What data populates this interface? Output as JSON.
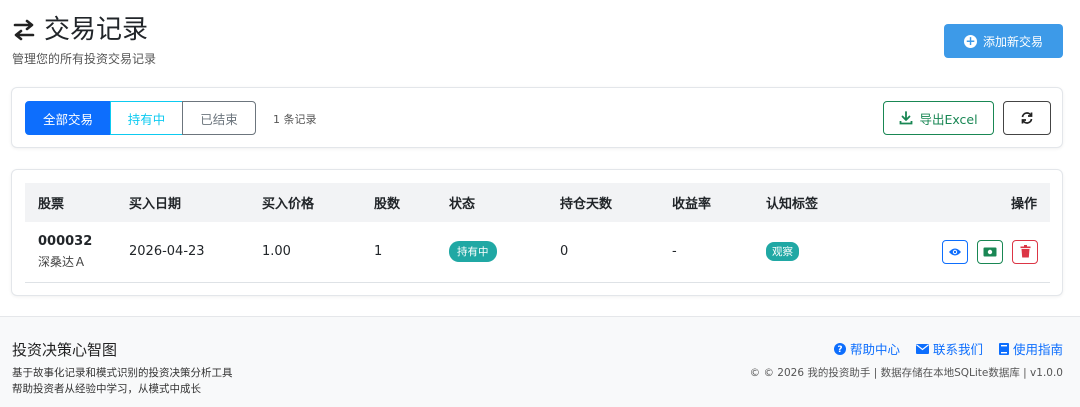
{
  "header": {
    "title": "交易记录",
    "subtitle": "管理您的所有投资交易记录",
    "add_button": "添加新交易",
    "add_icon": "plus-circle-icon",
    "title_icon": "swap-arrows-icon"
  },
  "filters": {
    "all": "全部交易",
    "holding": "持有中",
    "closed": "已结束",
    "record_count": "1 条记录",
    "export": "导出Excel",
    "export_icon": "download-icon",
    "refresh_icon": "refresh-icon"
  },
  "table": {
    "columns": [
      "股票",
      "买入日期",
      "买入价格",
      "股数",
      "状态",
      "持仓天数",
      "收益率",
      "认知标签",
      "操作"
    ],
    "rows": [
      {
        "code": "000032",
        "name": "深桑达Ａ",
        "buy_date": "2026-04-23",
        "buy_price": "1.00",
        "shares": "1",
        "status": "持有中",
        "days_held": "0",
        "return_rate": "-",
        "tag": "观察",
        "action_icons": [
          "eye-icon",
          "cash-icon",
          "trash-icon"
        ]
      }
    ]
  },
  "footer": {
    "title": "投资决策心智图",
    "desc_line1": "基于故事化记录和模式识别的投资决策分析工具",
    "desc_line2": "帮助投资者从经验中学习，从模式中成长",
    "links": {
      "help": "帮助中心",
      "contact": "联系我们",
      "guide": "使用指南"
    },
    "copyright": "© © 2026 我的投资助手 | 数据存储在本地SQLite数据库 | v1.0.0"
  },
  "colors": {
    "primary": "#0d6efd",
    "info": "#0dcaf0",
    "success": "#198754",
    "danger": "#dc3545",
    "teal_badge": "#20a8a4",
    "add_button": "#3d9ae8"
  }
}
